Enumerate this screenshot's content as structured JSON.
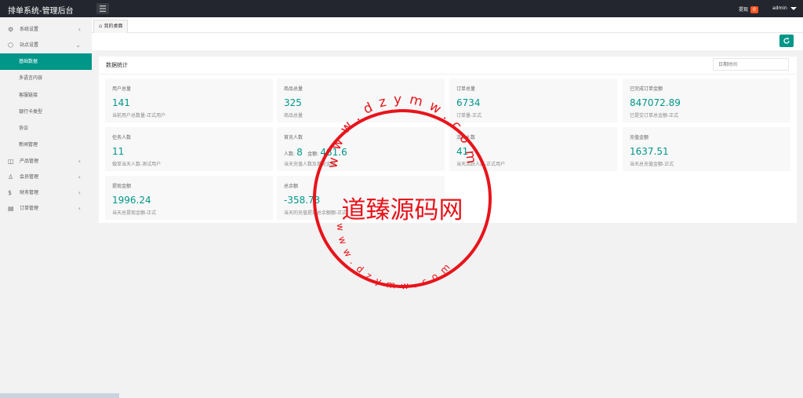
{
  "app": {
    "title": "排单系统-管理后台"
  },
  "topbar": {
    "notice_label": "提现",
    "notice_count": "0",
    "user_label": "admin"
  },
  "sidebar": {
    "items": [
      {
        "label": "系统设置",
        "icon": "gear-icon"
      },
      {
        "label": "站点设置",
        "icon": "cube-icon"
      }
    ],
    "subitems": [
      {
        "label": "基础数据",
        "active": true
      },
      {
        "label": "多语言内容",
        "active": false
      },
      {
        "label": "客服链接",
        "active": false
      },
      {
        "label": "银行卡类型",
        "active": false
      },
      {
        "label": "协议",
        "active": false
      },
      {
        "label": "新闻管理",
        "active": false
      }
    ],
    "items2": [
      {
        "label": "产品管理",
        "icon": "box-icon"
      },
      {
        "label": "会员管理",
        "icon": "user-icon"
      },
      {
        "label": "财务管理",
        "icon": "money-icon"
      },
      {
        "label": "订单管理",
        "icon": "order-icon"
      }
    ]
  },
  "tabs": [
    {
      "label": "我的桌面"
    }
  ],
  "panel": {
    "title": "数据统计",
    "date_placeholder": "日期时间"
  },
  "cards": [
    {
      "label": "用户总量",
      "value": "141",
      "desc": "当前用户总数量-正式用户"
    },
    {
      "label": "商品总量",
      "value": "325",
      "desc": "商品总量"
    },
    {
      "label": "订单总量",
      "value": "6734",
      "desc": "订单量-正式"
    },
    {
      "label": "已完成订单金额",
      "value": "847072.89",
      "desc": "已提交订单总金额-正式"
    },
    {
      "label": "任务人数",
      "value": "11",
      "desc": "做单当天人数-测试用户"
    },
    {
      "label": "首充人数",
      "inline": [
        {
          "s": "人数:",
          "n": "8"
        },
        {
          "s": "金额:",
          "n": "481.6"
        }
      ],
      "desc": "当天充值人数及首充金额"
    },
    {
      "label": "活跃人数",
      "value": "41",
      "desc": "当天活跃人数-正式用户"
    },
    {
      "label": "充值金额",
      "value": "1637.51",
      "desc": "当天总充值金额-正式"
    },
    {
      "label": "提现金额",
      "value": "1996.24",
      "desc": "当天总提现金额-正式"
    },
    {
      "label": "总余额",
      "value": "-358.73",
      "desc": "当天的充值提现总余额额-正式"
    }
  ],
  "watermark": {
    "top_text": "www.dzymw.com",
    "center_text": "道臻源码网",
    "bottom_text": "www.dzymw.com",
    "color": "#e8141b"
  },
  "colors": {
    "accent": "#009688",
    "topbar": "#23262e",
    "badge": "#ff5722"
  }
}
